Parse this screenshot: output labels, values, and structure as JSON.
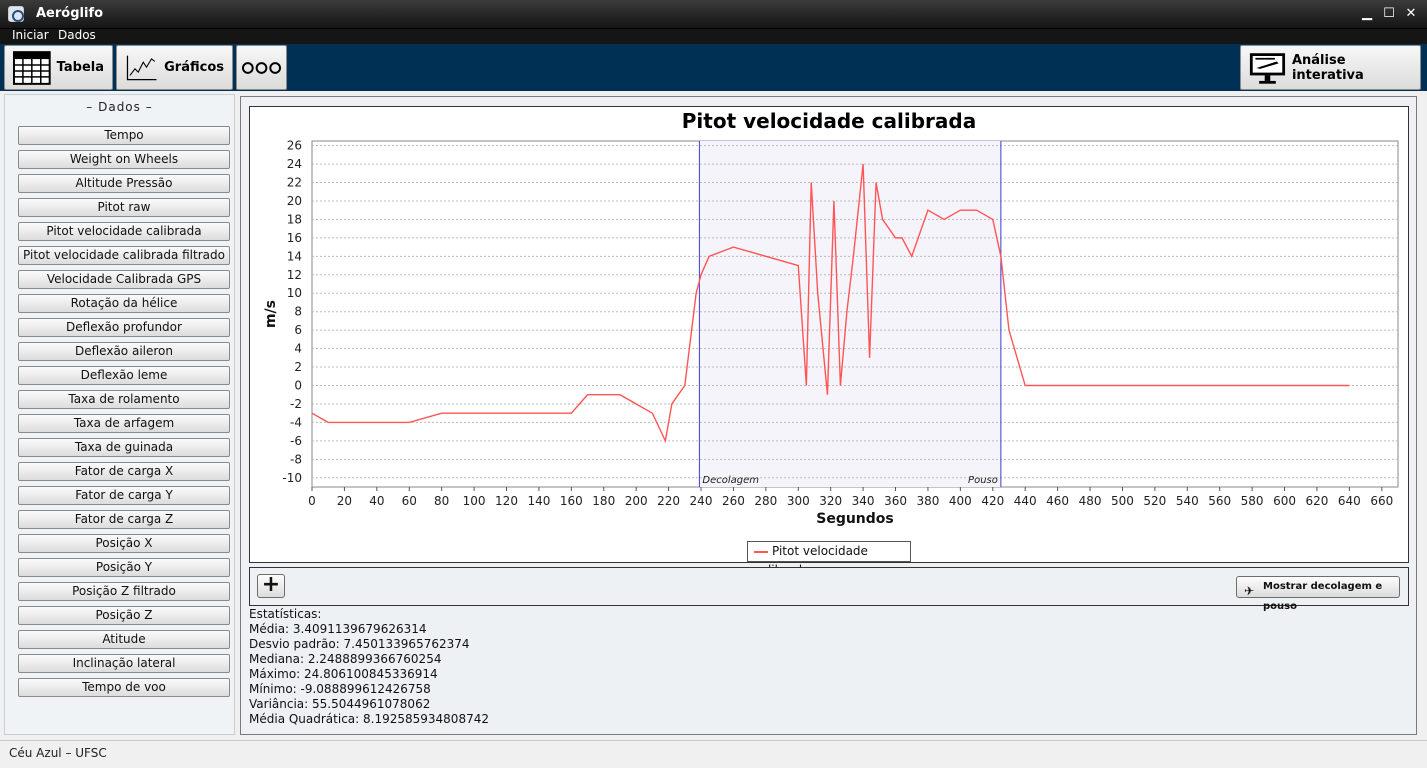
{
  "window": {
    "title": "Aeróglifo"
  },
  "menu": [
    "Iniciar",
    "Dados"
  ],
  "toolbar": {
    "tabela": "Tabela",
    "graficos": "Gráficos",
    "analise": "Análise interativa"
  },
  "sidebar": {
    "title": "– Dados –",
    "items": [
      "Tempo",
      "Weight on Wheels",
      "Altitude Pressão",
      "Pitot raw",
      "Pitot velocidade calibrada",
      "Pitot velocidade calibrada filtrado",
      "Velocidade Calibrada GPS",
      "Rotação da hélice",
      "Deflexão profundor",
      "Deflexão aileron",
      "Deflexão leme",
      "Taxa de rolamento",
      "Taxa de arfagem",
      "Taxa de guinada",
      "Fator de carga X",
      "Fator de carga Y",
      "Fator de carga Z",
      "Posição X",
      "Posição Y",
      "Posição Z filtrado",
      "Posição Z",
      "Atitude",
      "Inclinação lateral",
      "Tempo de voo"
    ]
  },
  "chart_data": {
    "type": "line",
    "title": "Pitot velocidade calibrada",
    "xlabel": "Segundos",
    "ylabel": "m/s",
    "xlim": [
      0,
      670
    ],
    "ylim": [
      -11,
      26.5
    ],
    "xticks": [
      0,
      20,
      40,
      60,
      80,
      100,
      120,
      140,
      160,
      180,
      200,
      220,
      240,
      260,
      280,
      300,
      320,
      340,
      360,
      380,
      400,
      420,
      440,
      460,
      480,
      500,
      520,
      540,
      560,
      580,
      600,
      620,
      640,
      660
    ],
    "yticks": [
      26,
      24,
      22,
      20,
      18,
      16,
      14,
      12,
      10,
      8,
      6,
      4,
      2,
      0,
      -2,
      -4,
      -6,
      -8,
      -10
    ],
    "grid": "horizontal",
    "legend": "bottom-center",
    "annotations": [
      {
        "x": 239,
        "label": "Decolagem"
      },
      {
        "x": 425,
        "label": "Pouso"
      }
    ],
    "series": [
      {
        "name": "Pitot velocidade calibrada",
        "color": "#ff5555",
        "x": [
          0,
          10,
          20,
          40,
          60,
          80,
          100,
          120,
          140,
          160,
          170,
          180,
          190,
          200,
          210,
          218,
          222,
          230,
          237,
          240,
          245,
          260,
          280,
          300,
          305,
          308,
          312,
          318,
          322,
          326,
          330,
          334,
          340,
          344,
          348,
          352,
          356,
          360,
          364,
          370,
          380,
          390,
          400,
          410,
          420,
          425,
          430,
          440,
          460,
          480,
          500,
          520,
          540,
          560,
          580,
          600,
          620,
          640
        ],
        "y": [
          -3,
          -4,
          -4,
          -4,
          -4,
          -3,
          -3,
          -3,
          -3,
          -3,
          -1,
          -1,
          -1,
          -2,
          -3,
          -6,
          -2,
          0,
          10,
          12,
          14,
          15,
          14,
          13,
          0,
          22,
          10,
          -1,
          20,
          0,
          8,
          14,
          24,
          3,
          22,
          18,
          17,
          16,
          16,
          14,
          19,
          18,
          19,
          19,
          18,
          14,
          6,
          0,
          0,
          0,
          0,
          0,
          0,
          0,
          0,
          0,
          0,
          0
        ]
      }
    ]
  },
  "controls": {
    "add": "+",
    "show_takeoff": "Mostrar decolagem e pouso"
  },
  "stats": {
    "header": "Estatísticas:",
    "media": "Média: 3.4091139679626314",
    "desvio": "Desvio padrão: 7.450133965762374",
    "mediana": "Mediana: 2.2488899366760254",
    "maximo": "Máximo: 24.806100845336914",
    "minimo": "Mínimo: -9.088899612426758",
    "variancia": "Variância: 55.5044961078062",
    "quadratica": "Média Quadrática: 8.192585934808742"
  },
  "status": "Céu Azul – UFSC"
}
